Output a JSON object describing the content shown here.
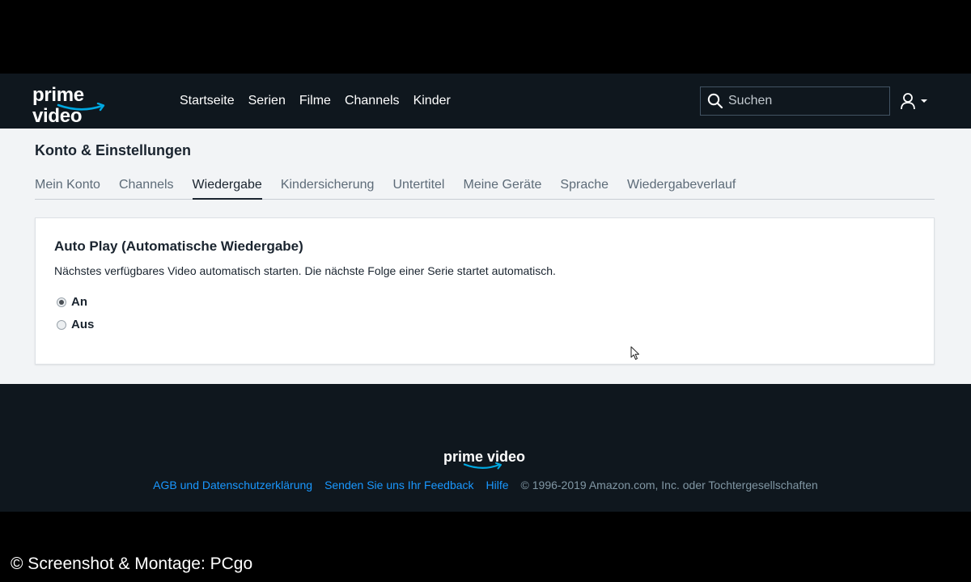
{
  "header": {
    "logo_text": "prime video",
    "nav": [
      "Startseite",
      "Serien",
      "Filme",
      "Channels",
      "Kinder"
    ],
    "search_placeholder": "Suchen"
  },
  "page": {
    "title": "Konto & Einstellungen",
    "tabs": [
      "Mein Konto",
      "Channels",
      "Wiedergabe",
      "Kindersicherung",
      "Untertitel",
      "Meine Geräte",
      "Sprache",
      "Wiedergabeverlauf"
    ],
    "active_tab": "Wiedergabe"
  },
  "autoplay": {
    "title": "Auto Play (Automatische Wiedergabe)",
    "description": "Nächstes verfügbares Video automatisch starten. Die nächste Folge einer Serie startet automatisch.",
    "options": [
      {
        "label": "An",
        "checked": true
      },
      {
        "label": "Aus",
        "checked": false
      }
    ]
  },
  "footer": {
    "logo_text": "prime video",
    "links": [
      "AGB und Datenschutzerklärung",
      "Senden Sie uns Ihr Feedback",
      "Hilfe"
    ],
    "copyright": "© 1996-2019 Amazon.com, Inc. oder Tochtergesellschaften"
  },
  "watermark": "© Screenshot & Montage: PCgo",
  "colors": {
    "header_bg": "#0f171e",
    "main_bg": "#f2f4f6",
    "accent_blue": "#00a8e1",
    "link_blue": "#1a98ff"
  }
}
